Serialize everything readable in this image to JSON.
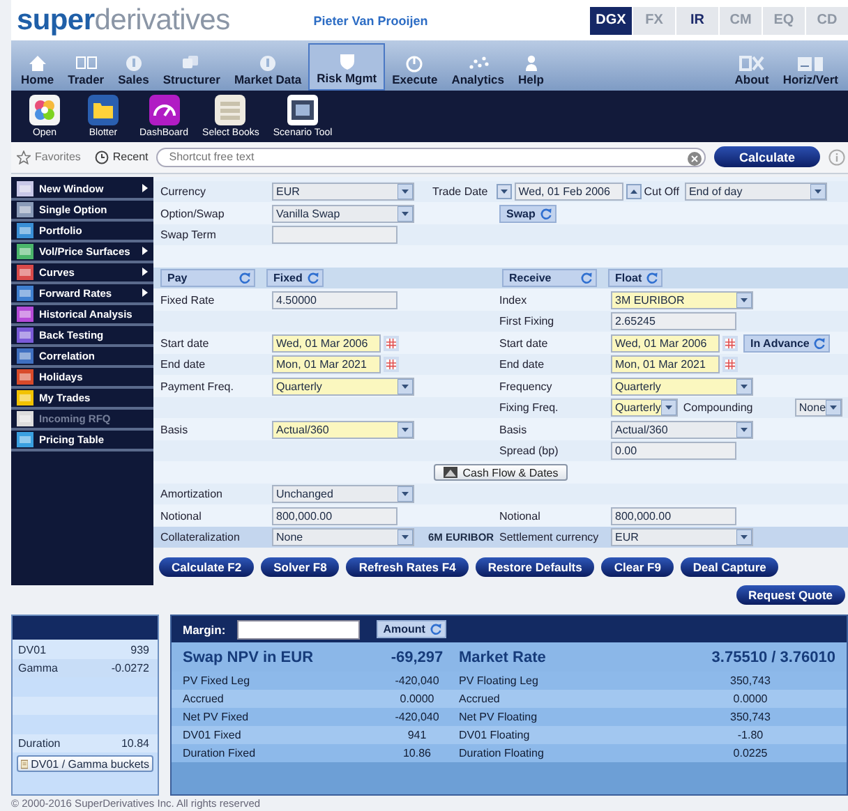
{
  "header": {
    "logo_bold": "super",
    "logo_light": "derivatives",
    "user": "Pieter Van Prooijen",
    "asset_tabs": [
      {
        "label": "DGX",
        "selected": true,
        "disabled": false
      },
      {
        "label": "FX",
        "selected": false,
        "disabled": true
      },
      {
        "label": "IR",
        "selected": false,
        "disabled": false
      },
      {
        "label": "CM",
        "selected": false,
        "disabled": true
      },
      {
        "label": "EQ",
        "selected": false,
        "disabled": true
      },
      {
        "label": "CD",
        "selected": false,
        "disabled": true
      }
    ]
  },
  "nav": {
    "items": [
      {
        "label": "Home",
        "selected": false
      },
      {
        "label": "Trader",
        "selected": false
      },
      {
        "label": "Sales",
        "selected": false
      },
      {
        "label": "Structurer",
        "selected": false
      },
      {
        "label": "Market Data",
        "selected": false
      },
      {
        "label": "Risk Mgmt",
        "selected": true
      },
      {
        "label": "Execute",
        "selected": false
      },
      {
        "label": "Analytics",
        "selected": false
      },
      {
        "label": "Help",
        "selected": false
      }
    ],
    "right_items": [
      "About",
      "Horiz/Vert"
    ]
  },
  "toolbar": [
    "Open",
    "Blotter",
    "DashBoard",
    "Select Books",
    "Scenario Tool"
  ],
  "search": {
    "favorites": "Favorites",
    "recent": "Recent",
    "placeholder": "Shortcut free text",
    "button": "Calculate"
  },
  "sidebar": {
    "items": [
      {
        "label": "New Window",
        "has_submenu": true,
        "disabled": false
      },
      {
        "label": "Single Option",
        "has_submenu": false,
        "disabled": false
      },
      {
        "label": "Portfolio",
        "has_submenu": false,
        "disabled": false
      },
      {
        "label": "Vol/Price Surfaces",
        "has_submenu": true,
        "disabled": false
      },
      {
        "label": "Curves",
        "has_submenu": true,
        "disabled": false
      },
      {
        "label": "Forward Rates",
        "has_submenu": true,
        "disabled": false
      },
      {
        "label": "Historical Analysis",
        "has_submenu": false,
        "disabled": false
      },
      {
        "label": "Back Testing",
        "has_submenu": false,
        "disabled": false
      },
      {
        "label": "Correlation",
        "has_submenu": false,
        "disabled": false
      },
      {
        "label": "Holidays",
        "has_submenu": false,
        "disabled": false
      },
      {
        "label": "My Trades",
        "has_submenu": false,
        "disabled": false
      },
      {
        "label": "Incoming RFQ",
        "has_submenu": false,
        "disabled": true
      },
      {
        "label": "Pricing Table",
        "has_submenu": false,
        "disabled": false
      }
    ]
  },
  "form": {
    "rows": [
      {
        "kind": "field",
        "left": [
          {
            "kind": "label",
            "text": "Currency"
          },
          {
            "kind": "select",
            "value": "EUR",
            "highlighted": false
          }
        ],
        "right": [
          {
            "kind": "label",
            "text": "Trade Date"
          },
          {
            "kind": "spin-down"
          },
          {
            "kind": "date",
            "value": "Wed, 01 Feb 2006",
            "highlighted": false
          },
          {
            "kind": "spin-up"
          },
          {
            "kind": "label",
            "text": "Cut Off"
          },
          {
            "kind": "select",
            "value": "End of day",
            "highlighted": false
          }
        ]
      },
      {
        "kind": "field",
        "left": [
          {
            "kind": "label",
            "text": "Option/Swap"
          },
          {
            "kind": "select",
            "value": "Vanilla Swap",
            "highlighted": false
          }
        ],
        "right": [
          {
            "kind": "toggle",
            "text": "Swap"
          }
        ]
      },
      {
        "kind": "field",
        "left": [
          {
            "kind": "label",
            "text": "Swap Term"
          },
          {
            "kind": "input"
          }
        ]
      },
      {
        "kind": "field"
      },
      {
        "kind": "header",
        "left": [
          {
            "kind": "toggle",
            "text": "Pay"
          },
          {
            "kind": "toggle",
            "text": "Fixed"
          }
        ],
        "right": [
          {
            "kind": "toggle",
            "text": "Receive"
          },
          {
            "kind": "toggle",
            "text": "Float"
          }
        ]
      },
      {
        "kind": "field",
        "left": [
          {
            "kind": "label",
            "text": "Fixed Rate"
          },
          {
            "kind": "input",
            "value": "4.50000"
          }
        ],
        "right": [
          {
            "kind": "label",
            "text": "Index"
          },
          {
            "kind": "select",
            "value": "3M EURIBOR",
            "highlighted": true
          }
        ]
      },
      {
        "kind": "field",
        "right": [
          {
            "kind": "label",
            "text": "First Fixing"
          },
          {
            "kind": "input",
            "value": "2.65245"
          }
        ]
      },
      {
        "kind": "field",
        "left": [
          {
            "kind": "label",
            "text": "Start date"
          },
          {
            "kind": "date",
            "value": "Wed, 01 Mar 2006",
            "highlighted": true
          },
          {
            "kind": "calendar"
          }
        ],
        "right": [
          {
            "kind": "label",
            "text": "Start date"
          },
          {
            "kind": "date",
            "value": "Wed, 01 Mar 2006",
            "highlighted": true
          },
          {
            "kind": "calendar"
          },
          {
            "kind": "toggle",
            "text": "In Advance"
          }
        ]
      },
      {
        "kind": "field",
        "left": [
          {
            "kind": "label",
            "text": "End date"
          },
          {
            "kind": "date",
            "value": "Mon, 01 Mar 2021",
            "highlighted": true
          },
          {
            "kind": "calendar"
          }
        ],
        "right": [
          {
            "kind": "label",
            "text": "End date"
          },
          {
            "kind": "date",
            "value": "Mon, 01 Mar 2021",
            "highlighted": true
          },
          {
            "kind": "calendar"
          }
        ]
      },
      {
        "kind": "field",
        "left": [
          {
            "kind": "label",
            "text": "Payment Freq."
          },
          {
            "kind": "select",
            "value": "Quarterly",
            "highlighted": true
          }
        ],
        "right": [
          {
            "kind": "label",
            "text": "Frequency"
          },
          {
            "kind": "select",
            "value": "Quarterly",
            "highlighted": true
          }
        ]
      },
      {
        "kind": "field",
        "right": [
          {
            "kind": "label",
            "text": "Fixing Freq."
          },
          {
            "kind": "select",
            "value": "Quarterly",
            "highlighted": true
          },
          {
            "kind": "label",
            "text": "Compounding"
          },
          {
            "kind": "select",
            "value": "None",
            "highlighted": false
          }
        ]
      },
      {
        "kind": "field",
        "left": [
          {
            "kind": "label",
            "text": "Basis"
          },
          {
            "kind": "select",
            "value": "Actual/360",
            "highlighted": true
          }
        ],
        "right": [
          {
            "kind": "label",
            "text": "Basis"
          },
          {
            "kind": "select",
            "value": "Actual/360",
            "highlighted": false
          }
        ]
      },
      {
        "kind": "field",
        "right": [
          {
            "kind": "label",
            "text": "Spread (bp)"
          },
          {
            "kind": "input",
            "value": "0.00"
          }
        ]
      },
      {
        "kind": "action",
        "items": [
          {
            "kind": "button",
            "text": "Cash Flow & Dates"
          }
        ]
      },
      {
        "kind": "field",
        "left": [
          {
            "kind": "label",
            "text": "Amortization"
          },
          {
            "kind": "select",
            "value": "Unchanged",
            "highlighted": false
          }
        ]
      },
      {
        "kind": "field",
        "left": [
          {
            "kind": "label",
            "text": "Notional"
          },
          {
            "kind": "input",
            "value": "800,000.00"
          }
        ],
        "right": [
          {
            "kind": "label",
            "text": "Notional"
          },
          {
            "kind": "input",
            "value": "800,000.00"
          }
        ]
      },
      {
        "kind": "band",
        "left": [
          {
            "kind": "label",
            "text": "Collateralization"
          },
          {
            "kind": "select",
            "value": "None",
            "highlighted": false
          },
          {
            "kind": "note",
            "text": "6M EURIBOR"
          }
        ],
        "right": [
          {
            "kind": "label",
            "text": "Settlement currency"
          },
          {
            "kind": "select",
            "value": "EUR",
            "highlighted": false
          }
        ]
      }
    ]
  },
  "actions": [
    "Calculate F2",
    "Solver F8",
    "Refresh Rates F4",
    "Restore Defaults",
    "Clear F9",
    "Deal Capture"
  ],
  "request_button": "Request Quote",
  "risk_panel": {
    "metrics": [
      {
        "label": "DV01",
        "value": "939"
      },
      {
        "label": "Gamma",
        "value": "-0.0272"
      }
    ],
    "duration": {
      "label": "Duration",
      "value": "10.84"
    },
    "button": "DV01 / Gamma buckets"
  },
  "results": {
    "margin_label": "Margin:",
    "amount_toggle": "Amount",
    "summary": {
      "title": "Swap NPV in EUR",
      "npv": "-69,297",
      "rate_label": "Market Rate",
      "rate": "3.75510 / 3.76010"
    },
    "rows": [
      {
        "label": "PV Fixed Leg",
        "value": "-420,040",
        "label2": "PV Floating Leg",
        "value2": "350,743"
      },
      {
        "label": "Accrued",
        "value": "0.0000",
        "label2": "Accrued",
        "value2": "0.0000"
      },
      {
        "label": "Net PV Fixed",
        "value": "-420,040",
        "label2": "Net PV Floating",
        "value2": "350,743"
      },
      {
        "label": "DV01 Fixed",
        "value": "941",
        "label2": "DV01 Floating",
        "value2": "-1.80"
      },
      {
        "label": "Duration Fixed",
        "value": "10.86",
        "label2": "Duration Floating",
        "value2": "0.0225"
      }
    ]
  },
  "footer": "© 2000-2016 SuperDerivatives Inc. All rights reserved"
}
